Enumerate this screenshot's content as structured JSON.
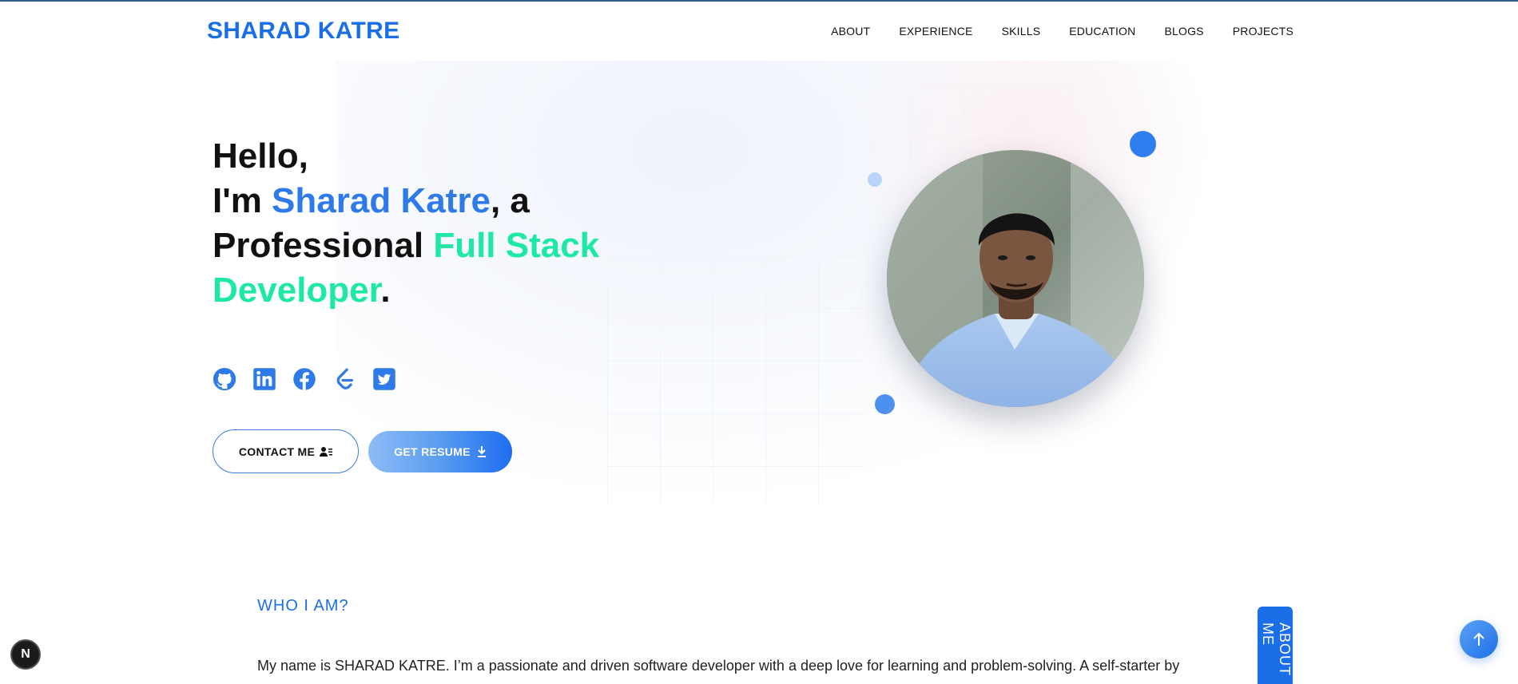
{
  "header": {
    "logo": "SHARAD KATRE",
    "nav": [
      "ABOUT",
      "EXPERIENCE",
      "SKILLS",
      "EDUCATION",
      "BLOGS",
      "PROJECTS"
    ]
  },
  "hero": {
    "line1": "Hello,",
    "line2_prefix": "I'm ",
    "name": "Sharad Katre",
    "line2_suffix": ", a",
    "line3_prefix": "Professional ",
    "role": "Full Stack Developer",
    "period": ".",
    "socials": [
      "github-icon",
      "linkedin-icon",
      "facebook-icon",
      "leetcode-icon",
      "twitter-icon"
    ],
    "contact_button": "CONTACT ME",
    "resume_button": "GET RESUME"
  },
  "about": {
    "heading": "WHO I AM?",
    "text": "My name is SHARAD KATRE. I’m a passionate and driven software developer with a deep love for learning and problem-solving. A self-starter by",
    "side_tab": "ABOUT ME"
  },
  "misc": {
    "badge": "N"
  },
  "colors": {
    "accent": "#1a6ee8",
    "name": "#2e7ae8",
    "role": "#1de9a4"
  }
}
